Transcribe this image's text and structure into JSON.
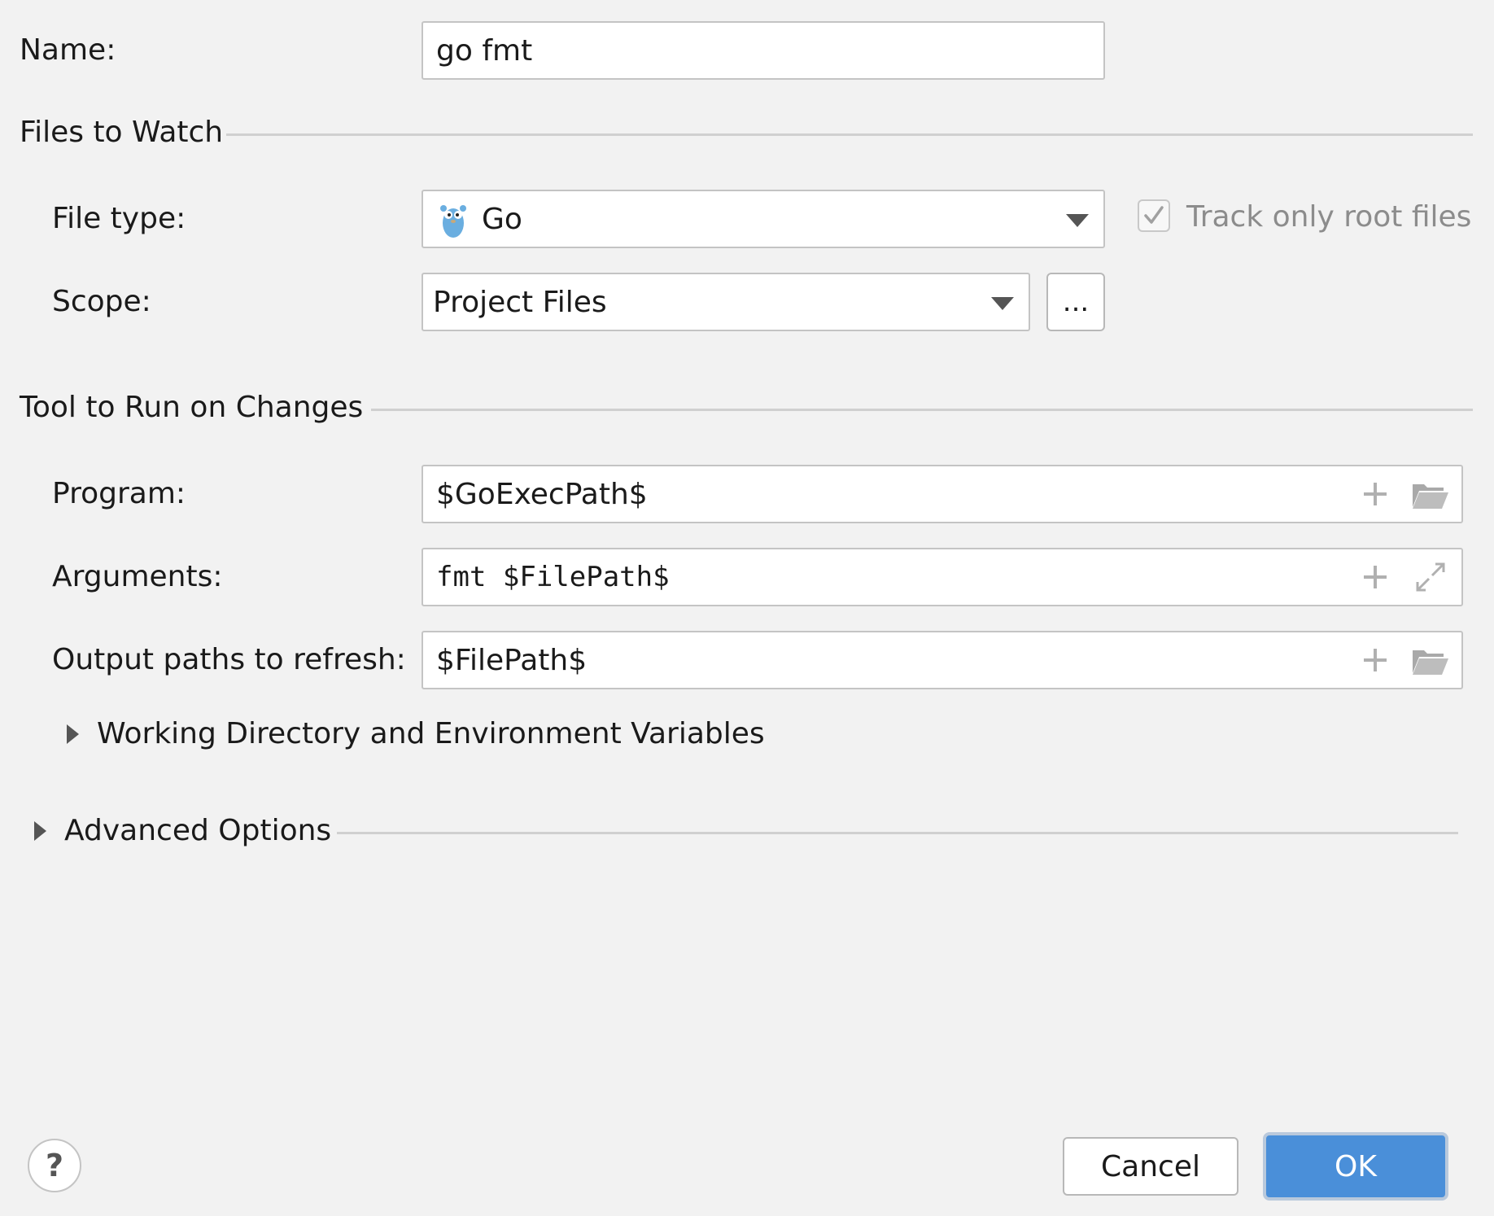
{
  "name": {
    "label": "Name:",
    "value": "go fmt"
  },
  "files_to_watch": {
    "section_title": "Files to Watch",
    "file_type": {
      "label": "File type:",
      "value": "Go",
      "icon": "go-gopher-icon"
    },
    "track_only_root": {
      "label": "Track only root files",
      "checked": true,
      "enabled": false
    },
    "scope": {
      "label": "Scope:",
      "value": "Project Files",
      "browse_label": "..."
    }
  },
  "tool": {
    "section_title": "Tool to Run on Changes",
    "program": {
      "label": "Program:",
      "value": "$GoExecPath$"
    },
    "arguments": {
      "label": "Arguments:",
      "value": "fmt $FilePath$"
    },
    "output_paths": {
      "label": "Output paths to refresh:",
      "value": "$FilePath$"
    },
    "working_dir_toggle": "Working Directory and Environment Variables"
  },
  "advanced": {
    "section_title": "Advanced Options"
  },
  "footer": {
    "help_label": "?",
    "cancel_label": "Cancel",
    "ok_label": "OK"
  },
  "colors": {
    "accent": "#4a8fd9",
    "background": "#f2f2f2",
    "border": "#c4c4c4",
    "disabled_text": "#8c8c8c"
  }
}
